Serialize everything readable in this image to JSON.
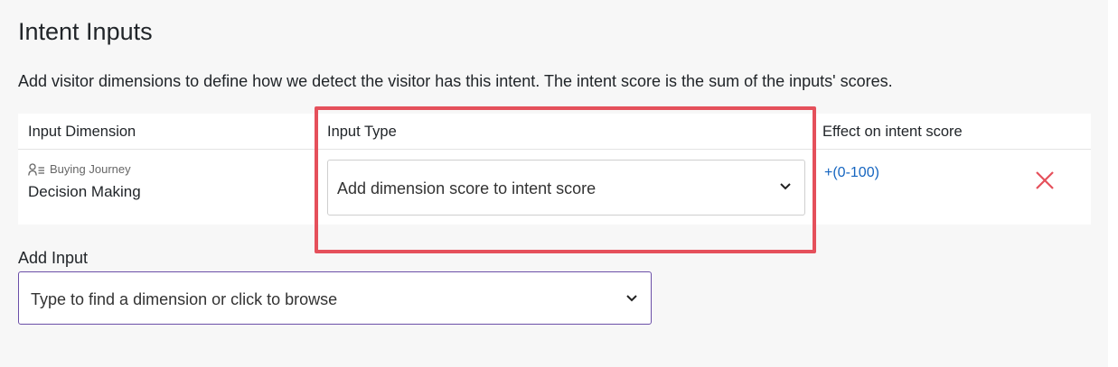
{
  "section": {
    "title": "Intent Inputs",
    "description": "Add visitor dimensions to define how we detect the visitor has this intent. The intent score is the sum of the inputs' scores."
  },
  "table": {
    "headers": [
      "Input Dimension",
      "Input Type",
      "Effect on intent score"
    ],
    "rows": [
      {
        "category": "Buying Journey",
        "category_icon": "person-list-icon",
        "dimension": "Decision Making",
        "input_type": "Add dimension score to intent score",
        "effect": "+(0-100)",
        "remove_icon": "close-icon"
      }
    ]
  },
  "add_input": {
    "label": "Add Input",
    "placeholder": "Type to find a dimension or click to browse"
  },
  "colors": {
    "highlight": "#e5505b",
    "link": "#1565c0",
    "remove": "#e5505b",
    "focus_border": "#6b4fa8"
  }
}
